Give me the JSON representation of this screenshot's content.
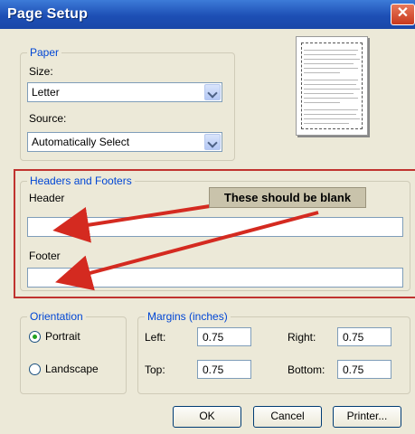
{
  "window": {
    "title": "Page Setup",
    "close_glyph": "✕"
  },
  "paper": {
    "legend": "Paper",
    "size_label": "Size:",
    "size_value": "Letter",
    "source_label": "Source:",
    "source_value": "Automatically Select"
  },
  "headers_footers": {
    "legend": "Headers and Footers",
    "header_label": "Header",
    "header_value": "",
    "footer_label": "Footer",
    "footer_value": ""
  },
  "annotation": {
    "text": "These should be blank",
    "color": "#d42a20"
  },
  "orientation": {
    "legend": "Orientation",
    "options": [
      {
        "label": "Portrait",
        "checked": true
      },
      {
        "label": "Landscape",
        "checked": false
      }
    ]
  },
  "margins": {
    "legend": "Margins (inches)",
    "left_label": "Left:",
    "left_value": "0.75",
    "right_label": "Right:",
    "right_value": "0.75",
    "top_label": "Top:",
    "top_value": "0.75",
    "bottom_label": "Bottom:",
    "bottom_value": "0.75"
  },
  "buttons": {
    "ok": "OK",
    "cancel": "Cancel",
    "printer": "Printer..."
  }
}
